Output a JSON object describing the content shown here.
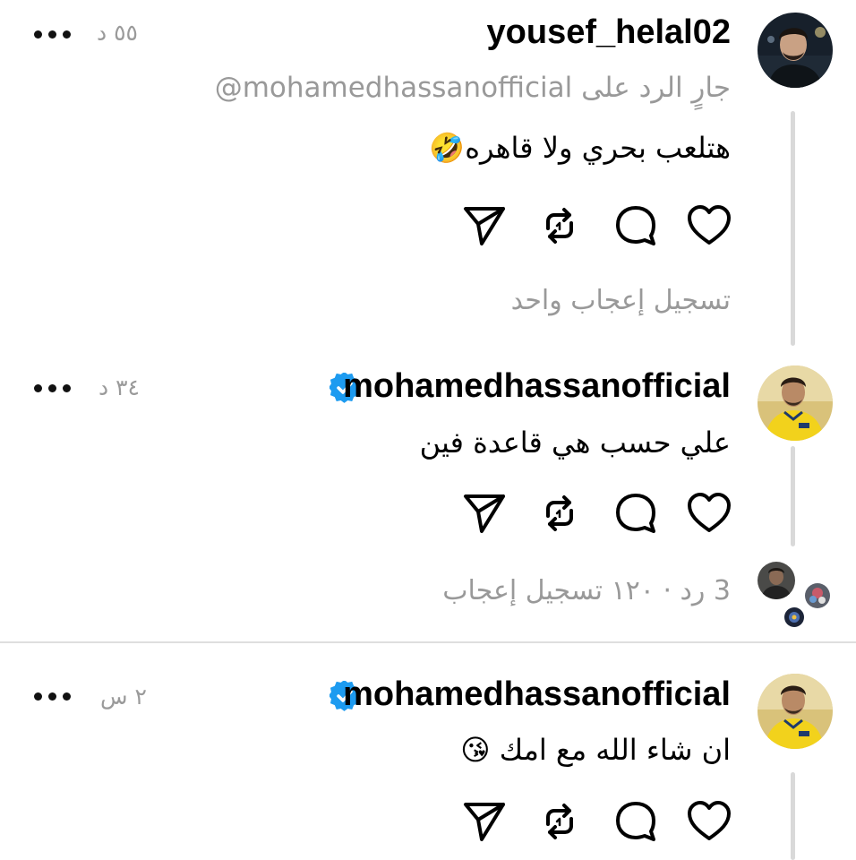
{
  "posts": [
    {
      "username": "yousef_helal02",
      "time": "٥٥ د",
      "reply_to_prefix": "جارٍ الرد على",
      "reply_to_user": "@mohamedhassanofficial",
      "text": "هتلعب بحري ولا قاهره🤣",
      "like_summary": "تسجيل إعجاب واحد"
    },
    {
      "username": "mohamedhassanofficial",
      "verified": true,
      "time": "٣٤ د",
      "text": "علي حسب هي قاعدة فين",
      "stats": "3 رد · ١٢٠ تسجيل إعجاب"
    },
    {
      "username": "mohamedhassanofficial",
      "verified": true,
      "time": "٢ س",
      "text": "ان شاء الله مع امك 😘"
    }
  ],
  "icons": {
    "like": "heart-icon",
    "reply": "comment-icon",
    "repost": "repost-icon",
    "share": "send-icon",
    "more": "more-options-icon",
    "verified": "verified-badge-icon"
  },
  "colors": {
    "verified": "#1d9bf0",
    "muted_text": "#9a9a9a",
    "divider": "#d9d9d9"
  }
}
